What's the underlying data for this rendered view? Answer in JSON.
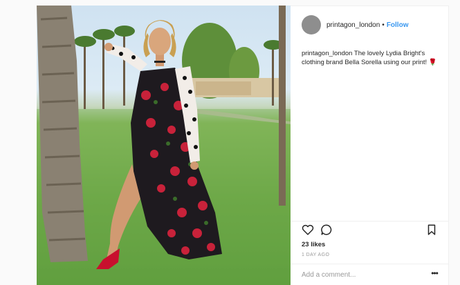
{
  "post": {
    "username": "printagon_london",
    "separator": "•",
    "follow_label": "Follow",
    "caption_user": "printagon_london",
    "caption_text": "The lovely Lydia Bright's clothing brand Bella Sorella using our print!",
    "caption_emoji": "🌹",
    "likes": "23 likes",
    "timestamp": "1 DAY AGO",
    "comment_placeholder": "Add a comment...",
    "more_icon": "•••"
  },
  "icons": {
    "like": "heart-outline-icon",
    "comment": "speech-bubble-icon",
    "save": "bookmark-outline-icon",
    "more": "more-options-icon"
  },
  "colors": {
    "follow": "#3897f0",
    "text": "#262626",
    "muted": "#999999",
    "divider": "#efefef"
  }
}
